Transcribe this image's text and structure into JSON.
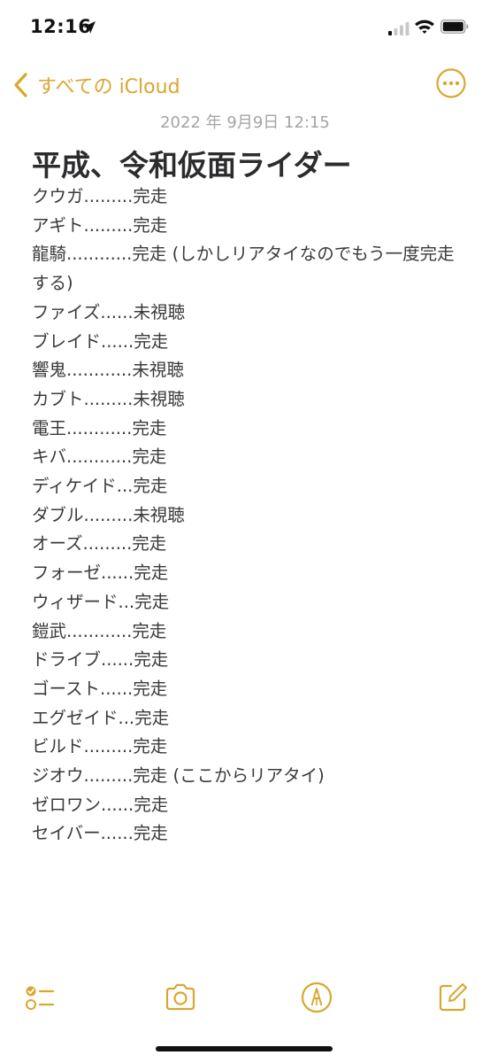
{
  "status_bar": {
    "time": "12:16"
  },
  "nav": {
    "back_label": "すべての iCloud"
  },
  "note": {
    "date": "2022 年 9月9日 12:15",
    "title": "平成、令和仮面ライダー",
    "lines": [
      "クウガ.........完走",
      "アギト.........完走",
      "龍騎............完走 (しかしリアタイなのでもう一度完走する)",
      "ファイズ......未視聴",
      "ブレイド......完走",
      "響鬼............未視聴",
      "カブト.........未視聴",
      "電王............完走",
      "キバ............完走",
      "ディケイド...完走",
      "ダブル.........未視聴",
      "オーズ.........完走",
      "フォーゼ......完走",
      "ウィザード...完走",
      "鎧武............完走",
      "ドライブ......完走",
      "ゴースト......完走",
      "エグゼイド...完走",
      "ビルド.........完走",
      "ジオウ.........完走 (ここからリアタイ)",
      "ゼロワン......完走",
      "セイバー......完走"
    ]
  },
  "theme": {
    "accent": "#d9a730",
    "text": "#3a3a3c",
    "date_color": "#a4a4a8"
  },
  "icons": {
    "status": [
      "location-arrow-icon",
      "signal-icon",
      "wifi-icon",
      "battery-icon"
    ],
    "nav": [
      "chevron-left-icon",
      "more-icon"
    ],
    "toolbar": [
      "checklist-icon",
      "camera-icon",
      "markup-icon",
      "compose-icon"
    ]
  }
}
